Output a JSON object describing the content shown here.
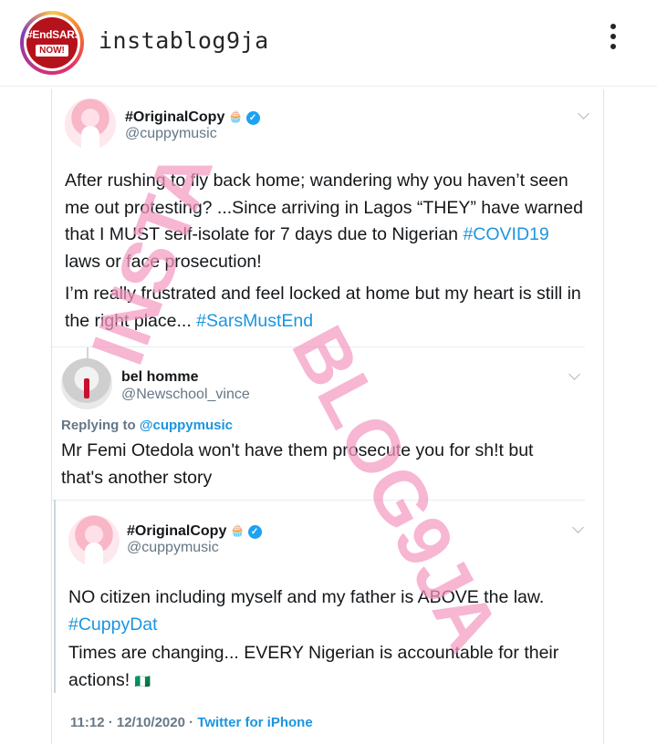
{
  "instagram": {
    "username": "instablog9ja",
    "avatar_line1": "#EndSARS",
    "avatar_line2": "NOW!",
    "more_icon": "more-vertical-icon"
  },
  "tweet1": {
    "name": "#OriginalCopy",
    "handle": "@cuppymusic",
    "para1_text": "After rushing to fly back home; wandering why you haven’t seen me out protesting? ...Since arriving in Lagos “THEY” have warned that I MUST self-isolate for 7 days due to Nigerian ",
    "para1_hashtag": "#COVID19",
    "para1_after": " laws or face prosecution!",
    "para2_text": "I’m really frustrated and feel locked at home but my heart is still in the right place... ",
    "para2_hashtag": "#SarsMustEnd"
  },
  "reply": {
    "name": "bel homme",
    "handle": "@Newschool_vince",
    "replying_label": "Replying to ",
    "replying_handle": "@cuppymusic",
    "text": "Mr Femi Otedola won't have them prosecute you for sh!t but that's another story"
  },
  "tweet2": {
    "name": "#OriginalCopy",
    "handle": "@cuppymusic",
    "para1_text": "NO citizen including myself and my father is ABOVE the law.",
    "para1_hashtag": "#CuppyDat",
    "para2_text": "Times are changing... EVERY Nigerian is accountable for their actions! ",
    "flag": "🇳🇬",
    "time": "11:12 · 12/10/2020 · ",
    "source": "Twitter for iPhone"
  },
  "watermark": {
    "line1": "INSTA",
    "line2": "BLOG9JA"
  },
  "colors": {
    "link": "#1b95e0",
    "verified": "#1da1f2",
    "watermark": "#f49ac1"
  }
}
